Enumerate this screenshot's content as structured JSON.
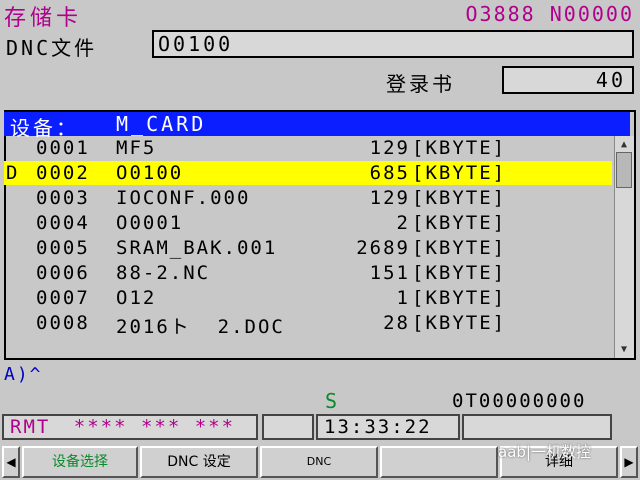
{
  "header": {
    "title": "存储卡",
    "program": "O3888 N00000"
  },
  "dnc": {
    "label": "DNC文件",
    "value": "O0100"
  },
  "directory": {
    "label": "登录书",
    "value": "40"
  },
  "device": {
    "label": "设备：",
    "value": "M_CARD"
  },
  "files": [
    {
      "marker": "",
      "no": "0001",
      "name": "MF5",
      "size": "129",
      "unit": "[KBYTE]"
    },
    {
      "marker": "D",
      "no": "0002",
      "name": "O0100",
      "size": "685",
      "unit": "[KBYTE]"
    },
    {
      "marker": "",
      "no": "0003",
      "name": "IOCONF.000",
      "size": "129",
      "unit": "[KBYTE]"
    },
    {
      "marker": "",
      "no": "0004",
      "name": "O0001",
      "size": "2",
      "unit": "[KBYTE]"
    },
    {
      "marker": "",
      "no": "0005",
      "name": "SRAM_BAK.001",
      "size": "2689",
      "unit": "[KBYTE]"
    },
    {
      "marker": "",
      "no": "0006",
      "name": "88-2.NC",
      "size": "151",
      "unit": "[KBYTE]"
    },
    {
      "marker": "",
      "no": "0007",
      "name": "O12",
      "size": "1",
      "unit": "[KBYTE]"
    },
    {
      "marker": "",
      "no": "0008",
      "name": "2016ト  2.DOC",
      "size": "28",
      "unit": "[KBYTE]"
    }
  ],
  "input_prompt": "A)^",
  "status": {
    "s_label": "S",
    "t_value": "0T00000000",
    "mode": "RMT",
    "stars": "**** *** ***",
    "time": "13:33:22"
  },
  "softkeys": [
    "设备选择",
    "DNC 设定",
    "DNC",
    "",
    "详细"
  ],
  "watermark": "aab|一机数控",
  "colors": {
    "title": "#b0008c",
    "device_bar": "#0a1eff",
    "selected_row": "#ffff00",
    "softkey_green": "#0a8a2a"
  }
}
